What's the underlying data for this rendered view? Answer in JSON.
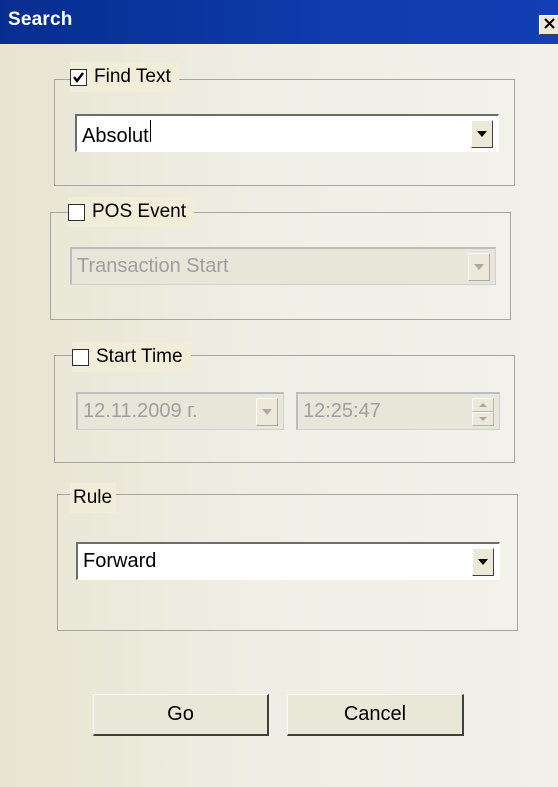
{
  "dialog": {
    "title": "Search",
    "close_icon": "close-icon"
  },
  "find_text": {
    "label": "Find Text",
    "checked": true,
    "value": "Absolut"
  },
  "pos_event": {
    "label": "POS Event",
    "checked": false,
    "value": "Transaction Start",
    "enabled": false
  },
  "start_time": {
    "label": "Start Time",
    "checked": false,
    "date_value": "12.11.2009 г.",
    "time_value": "12:25:47",
    "enabled": false
  },
  "rule": {
    "label": "Rule",
    "value": "Forward"
  },
  "buttons": {
    "go": "Go",
    "cancel": "Cancel"
  },
  "colors": {
    "titlebar": "#0e3cad",
    "dialog_bg": "#eeeee4",
    "disabled_text": "#9f9f9f"
  }
}
